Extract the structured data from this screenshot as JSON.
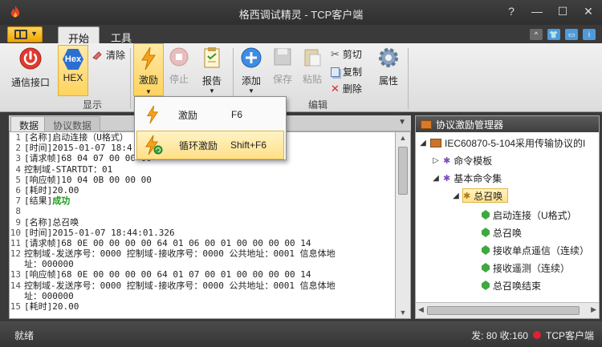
{
  "window": {
    "title": "格西调试精灵 - TCP客户端"
  },
  "window_controls": {
    "help": "?",
    "minimize": "—",
    "maximize": "☐",
    "close": "✕"
  },
  "tabs": [
    {
      "label": "开始"
    },
    {
      "label": "工具"
    }
  ],
  "ribbon": {
    "comm": {
      "label": "通信接口"
    },
    "hex": {
      "icon_text": "Hex",
      "label": "HEX"
    },
    "clear": {
      "label": "清除"
    },
    "display_group": "显示",
    "stimulus": {
      "label": "激励"
    },
    "stop": {
      "label": "停止"
    },
    "report": {
      "label": "报告"
    },
    "add": {
      "label": "添加"
    },
    "save": {
      "label": "保存"
    },
    "paste": {
      "label": "粘贴"
    },
    "cut": {
      "label": "剪切"
    },
    "copy": {
      "label": "复制"
    },
    "delete": {
      "label": "删除"
    },
    "properties": {
      "label": "属性"
    },
    "edit_group": "编辑"
  },
  "dropdown": {
    "items": [
      {
        "label": "激励",
        "shortcut": "F6"
      },
      {
        "label": "循环激励",
        "shortcut": "Shift+F6"
      }
    ]
  },
  "left_pane": {
    "tabs": [
      {
        "label": "数据"
      },
      {
        "label": "协议数据"
      }
    ],
    "lines": [
      {
        "no": "1",
        "text": "[名称]启动连接（U格式）"
      },
      {
        "no": "2",
        "text": "[时间]2015-01-07 18:4"
      },
      {
        "no": "3",
        "text": "[请求帧]68 04 07 00 00 00"
      },
      {
        "no": "4",
        "text": " 控制域-STARTDT：01"
      },
      {
        "no": "5",
        "text": "[响应帧]10 04 0B 00 00 00"
      },
      {
        "no": "6",
        "text": "[耗时]20.00"
      },
      {
        "no": "7",
        "text": "[结果]",
        "ok": "成功"
      },
      {
        "no": "8",
        "text": ""
      },
      {
        "no": "9",
        "text": "[名称]总召唤"
      },
      {
        "no": "10",
        "text": "[时间]2015-01-07 18:44:01.326"
      },
      {
        "no": "11",
        "text": "[请求帧]68 0E 00 00 00 00 64 01 06 00 01 00 00 00 00 14"
      },
      {
        "no": "12",
        "text": " 控制域-发送序号：0000  控制域-接收序号：0000  公共地址：0001  信息体地"
      },
      {
        "no": "",
        "text": "  址：000000"
      },
      {
        "no": "13",
        "text": "[响应帧]68 0E 00 00 00 00 64 01 07 00 01 00 00 00 00 14"
      },
      {
        "no": "14",
        "text": " 控制域-发送序号：0000  控制域-接收序号：0000  公共地址：0001  信息体地"
      },
      {
        "no": "",
        "text": "  址：000000"
      },
      {
        "no": "15",
        "text": "[耗时]20.00"
      }
    ]
  },
  "right_pane": {
    "title": "协议激励管理器",
    "tree": {
      "root": "IEC60870-5-104采用传输协议的I",
      "template": "命令模板",
      "basic": "基本命令集",
      "selected": "总召唤",
      "leaves": [
        "启动连接（U格式）",
        "总召唤",
        "接收单点遥信（连续）",
        "接收遥测（连续）",
        "总召唤结束"
      ]
    }
  },
  "status": {
    "left": "就绪",
    "right": "发: 80  收:160",
    "conn": "TCP客户端"
  }
}
